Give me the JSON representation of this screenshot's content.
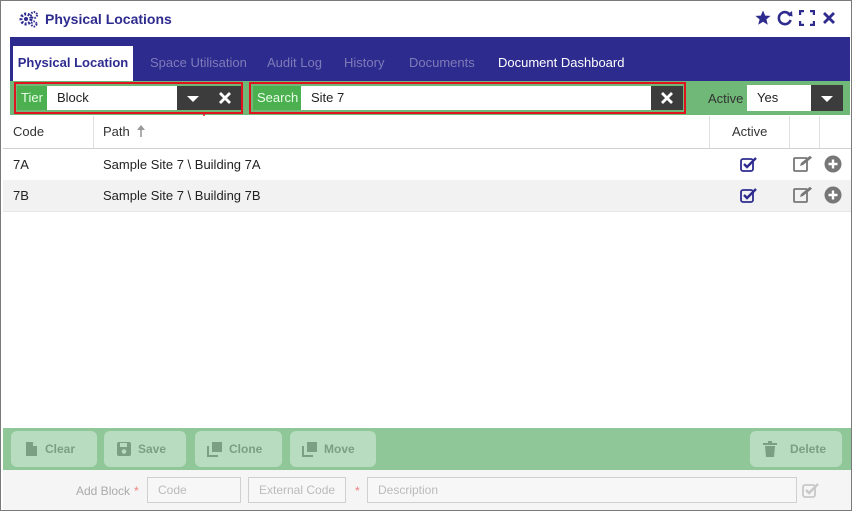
{
  "window": {
    "title": "Physical Locations",
    "icons": [
      "star-icon",
      "refresh-icon",
      "expand-icon",
      "close-icon"
    ]
  },
  "tabs": [
    {
      "label": "Physical Location",
      "state": "active"
    },
    {
      "label": "Space Utilisation",
      "state": "disabled"
    },
    {
      "label": "Audit Log",
      "state": "disabled"
    },
    {
      "label": "History",
      "state": "disabled"
    },
    {
      "label": "Documents",
      "state": "disabled"
    },
    {
      "label": "Document Dashboard",
      "state": "enabled"
    }
  ],
  "filters": {
    "tier_label": "Tier",
    "tier_value": "Block",
    "search_label": "Search",
    "search_value": "Site 7",
    "active_label": "Active",
    "active_value": "Yes"
  },
  "table": {
    "columns": [
      "Code",
      "Path",
      "Active"
    ],
    "rows": [
      {
        "code": "7A",
        "path": "Sample Site 7 \\ Building 7A",
        "active": true
      },
      {
        "code": "7B",
        "path": "Sample Site 7 \\ Building 7B",
        "active": true
      }
    ]
  },
  "footer": {
    "clear": "Clear",
    "save": "Save",
    "clone": "Clone",
    "move": "Move",
    "delete": "Delete"
  },
  "add_row": {
    "label": "Add Block",
    "code_placeholder": "Code",
    "external_code_placeholder": "External Code",
    "description_placeholder": "Description"
  },
  "colors": {
    "brand": "#2e2b8f",
    "filter_bar": "#6fb877",
    "highlight": "#e0141e",
    "footer": "#8fc798"
  }
}
